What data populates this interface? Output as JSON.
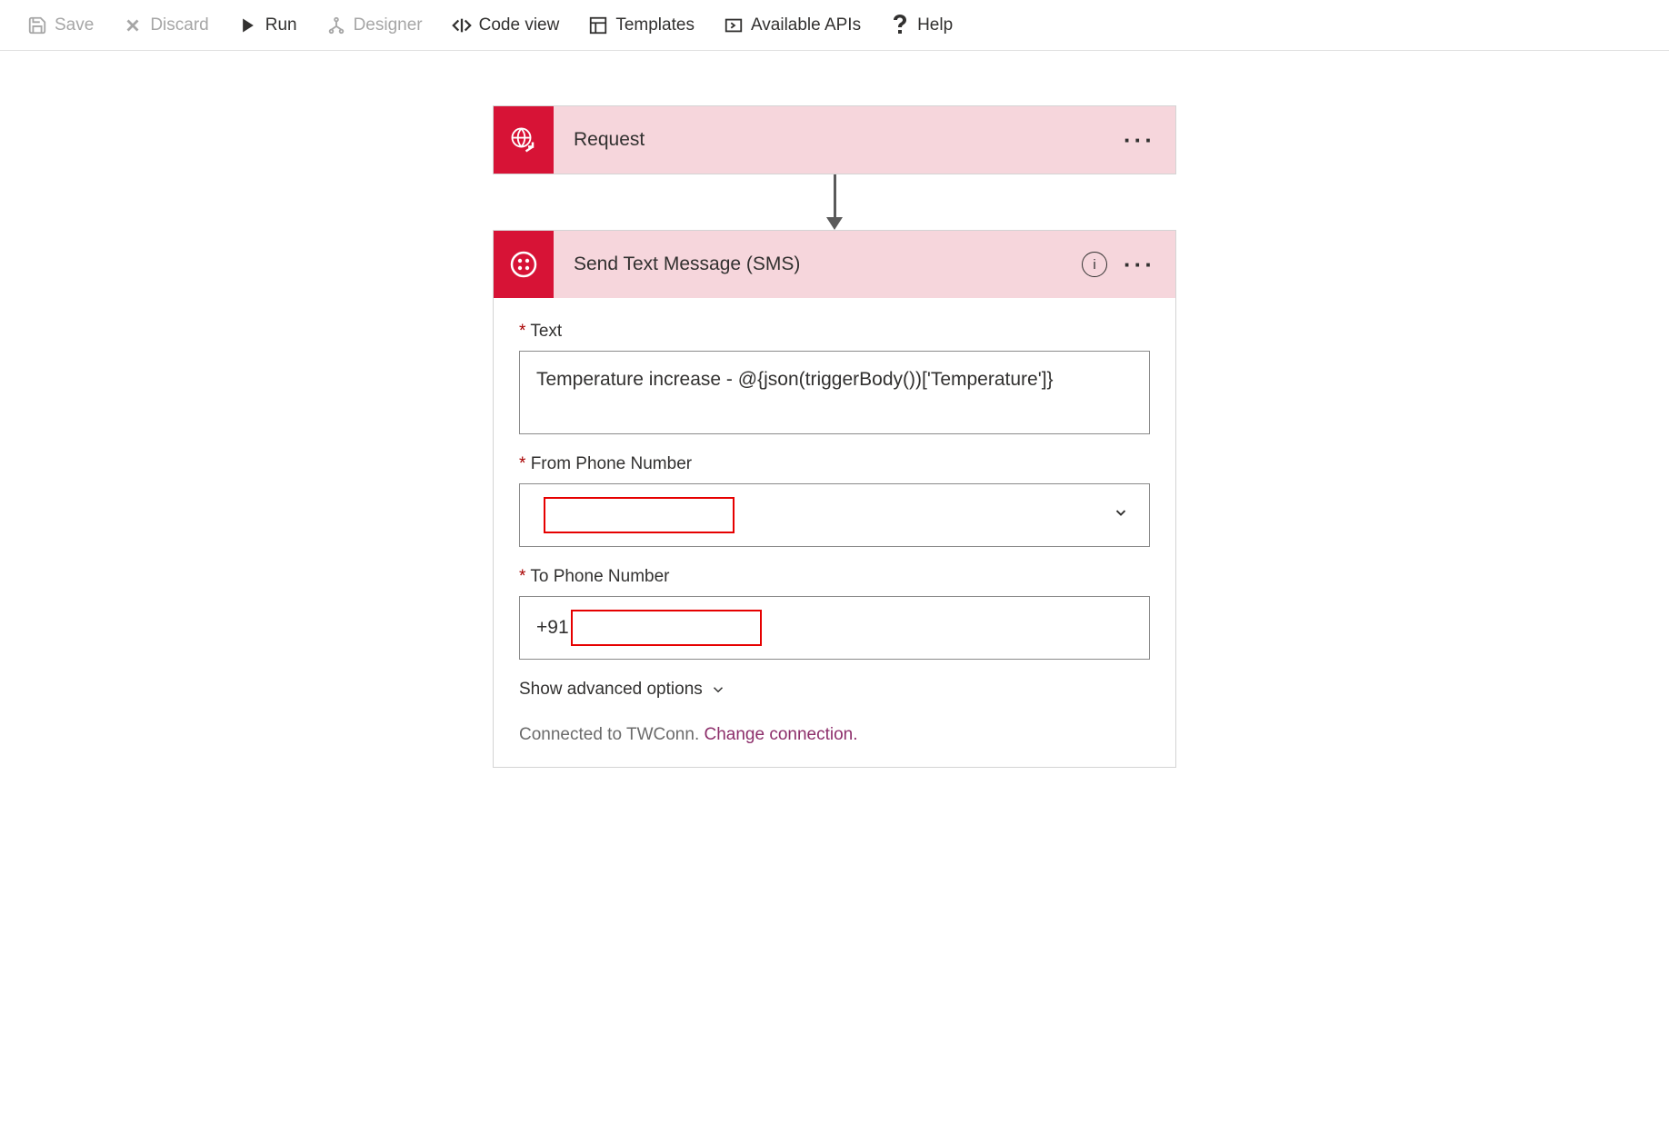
{
  "toolbar": {
    "save": "Save",
    "discard": "Discard",
    "run": "Run",
    "designer": "Designer",
    "code_view": "Code view",
    "templates": "Templates",
    "available_apis": "Available APIs",
    "help": "Help"
  },
  "request_card": {
    "title": "Request"
  },
  "sms_card": {
    "title": "Send Text Message (SMS)",
    "fields": {
      "text": {
        "label": "Text",
        "value": "Temperature increase - @{json(triggerBody())['Temperature']}"
      },
      "from": {
        "label": "From Phone Number",
        "value": ""
      },
      "to": {
        "label": "To Phone Number",
        "value_prefix": "+91"
      }
    },
    "advanced_label": "Show advanced options",
    "connected_prefix": "Connected to ",
    "connected_name": "TWConn",
    "connected_suffix": ". ",
    "change_link": "Change connection."
  }
}
